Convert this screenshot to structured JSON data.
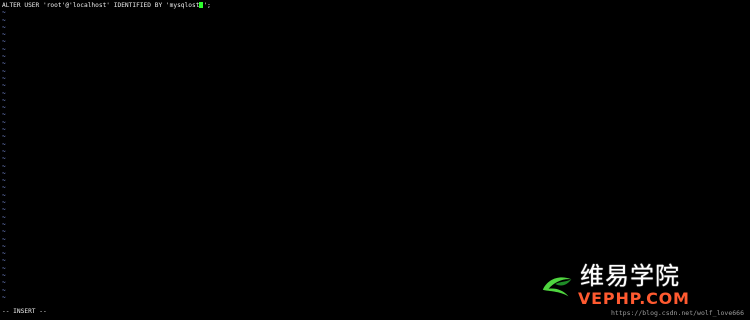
{
  "editor": {
    "lines": [
      {
        "text_before_cursor": "ALTER USER 'root'@'localhost' IDENTIFIED BY 'mysqlost",
        "text_after_cursor": "';"
      }
    ],
    "empty_line_marker": "~",
    "mode": "-- INSERT --"
  },
  "watermark": {
    "brand_cn": "维易学院",
    "site": "VEPHP.COM",
    "url": "https://blog.csdn.net/wolf_love666",
    "logo_colors": {
      "primary": "#4fd53f",
      "dark": "#1f8c27"
    },
    "site_color": "#ff5a30"
  },
  "colors": {
    "background": "#000000",
    "text": "#ededed",
    "tilde": "#8ea6ff",
    "cursor": "#2dff2d"
  }
}
